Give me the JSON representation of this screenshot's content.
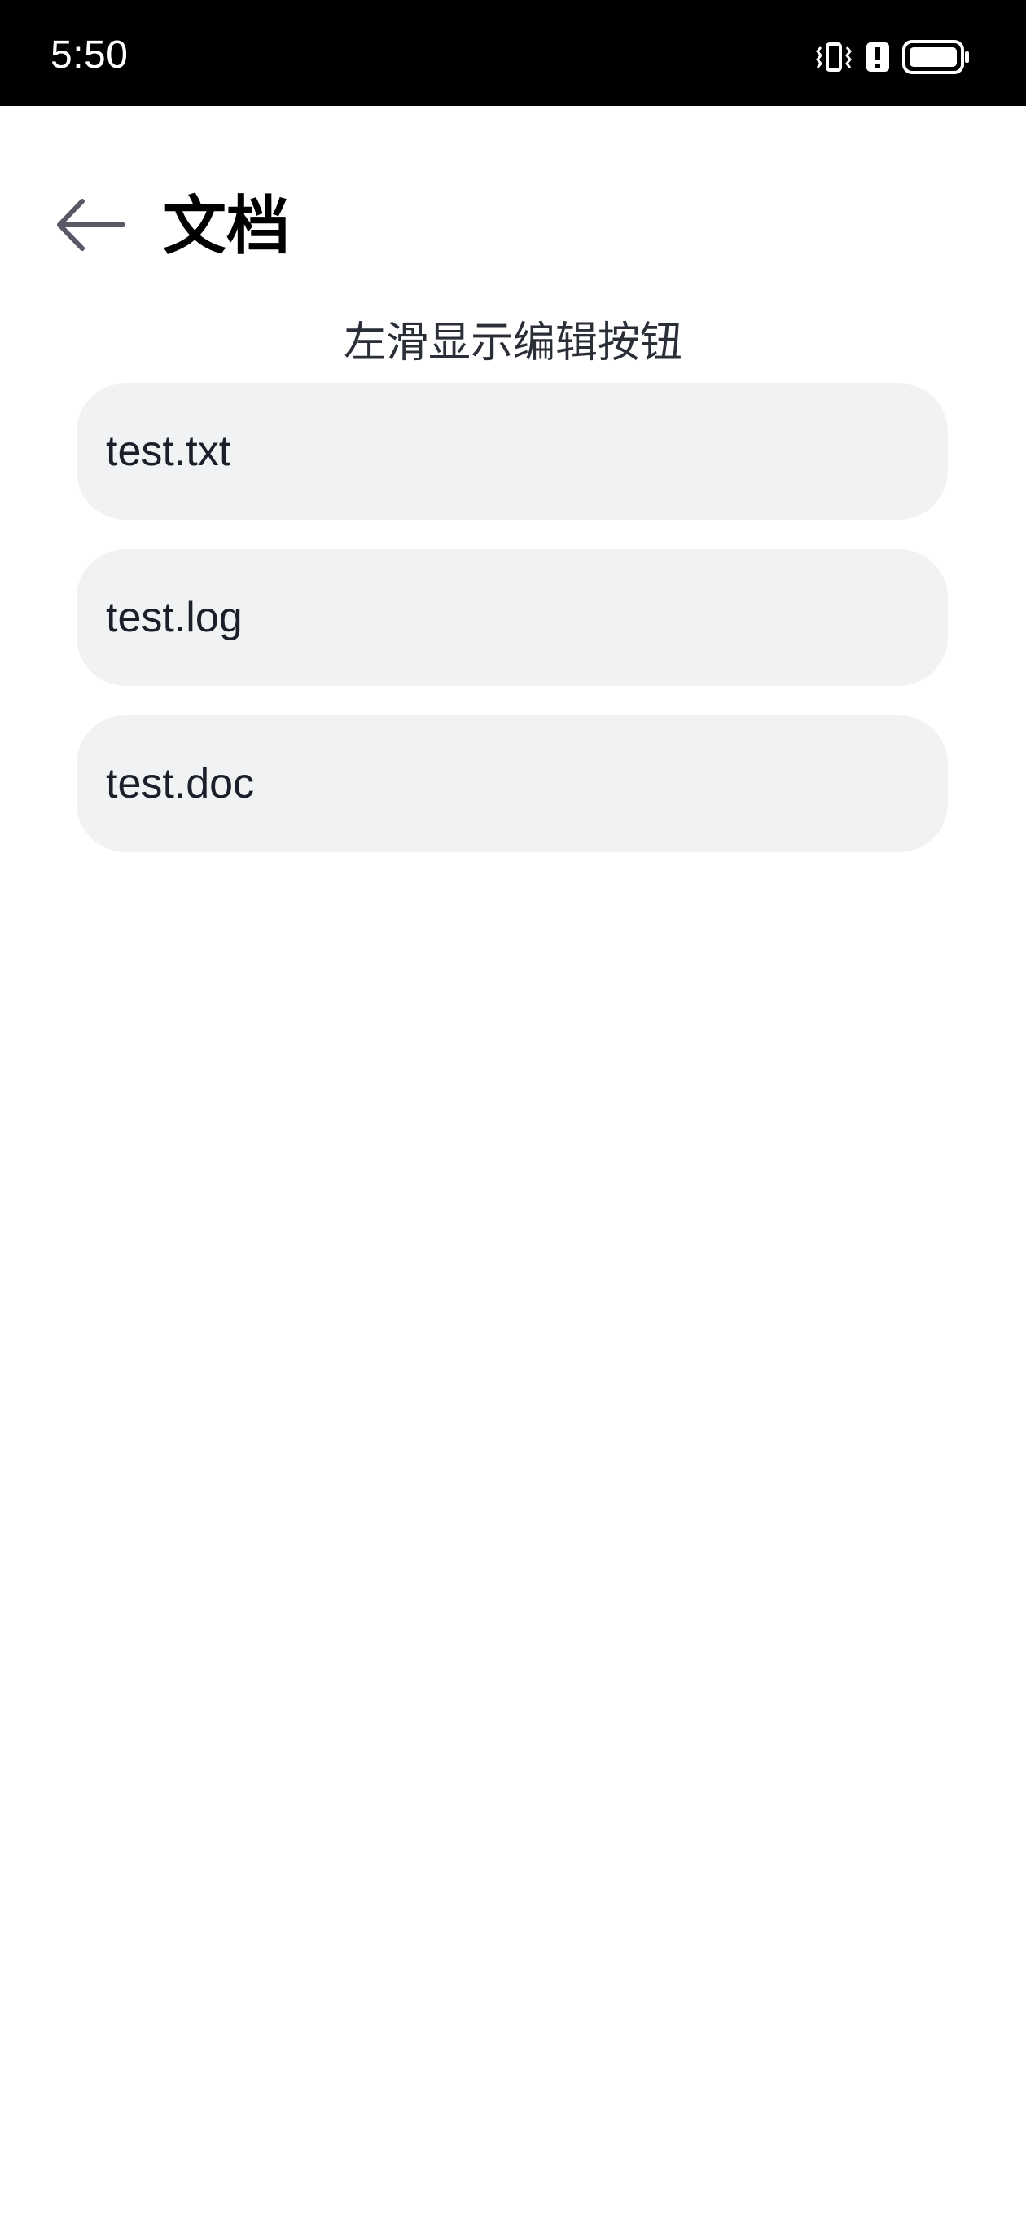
{
  "status_bar": {
    "time": "5:50",
    "icons": [
      "vibrate-icon",
      "alert-icon",
      "battery-icon"
    ]
  },
  "header": {
    "title": "文档",
    "back_icon": "arrow-left-icon"
  },
  "hint": "左滑显示编辑按钮",
  "files": [
    {
      "name": "test.txt"
    },
    {
      "name": "test.log"
    },
    {
      "name": "test.doc"
    }
  ],
  "colors": {
    "status_bar_bg": "#000000",
    "page_bg": "#ffffff",
    "item_bg": "#f1f2f4",
    "text_primary": "#1b1f2a",
    "back_icon": "#5b5866"
  }
}
